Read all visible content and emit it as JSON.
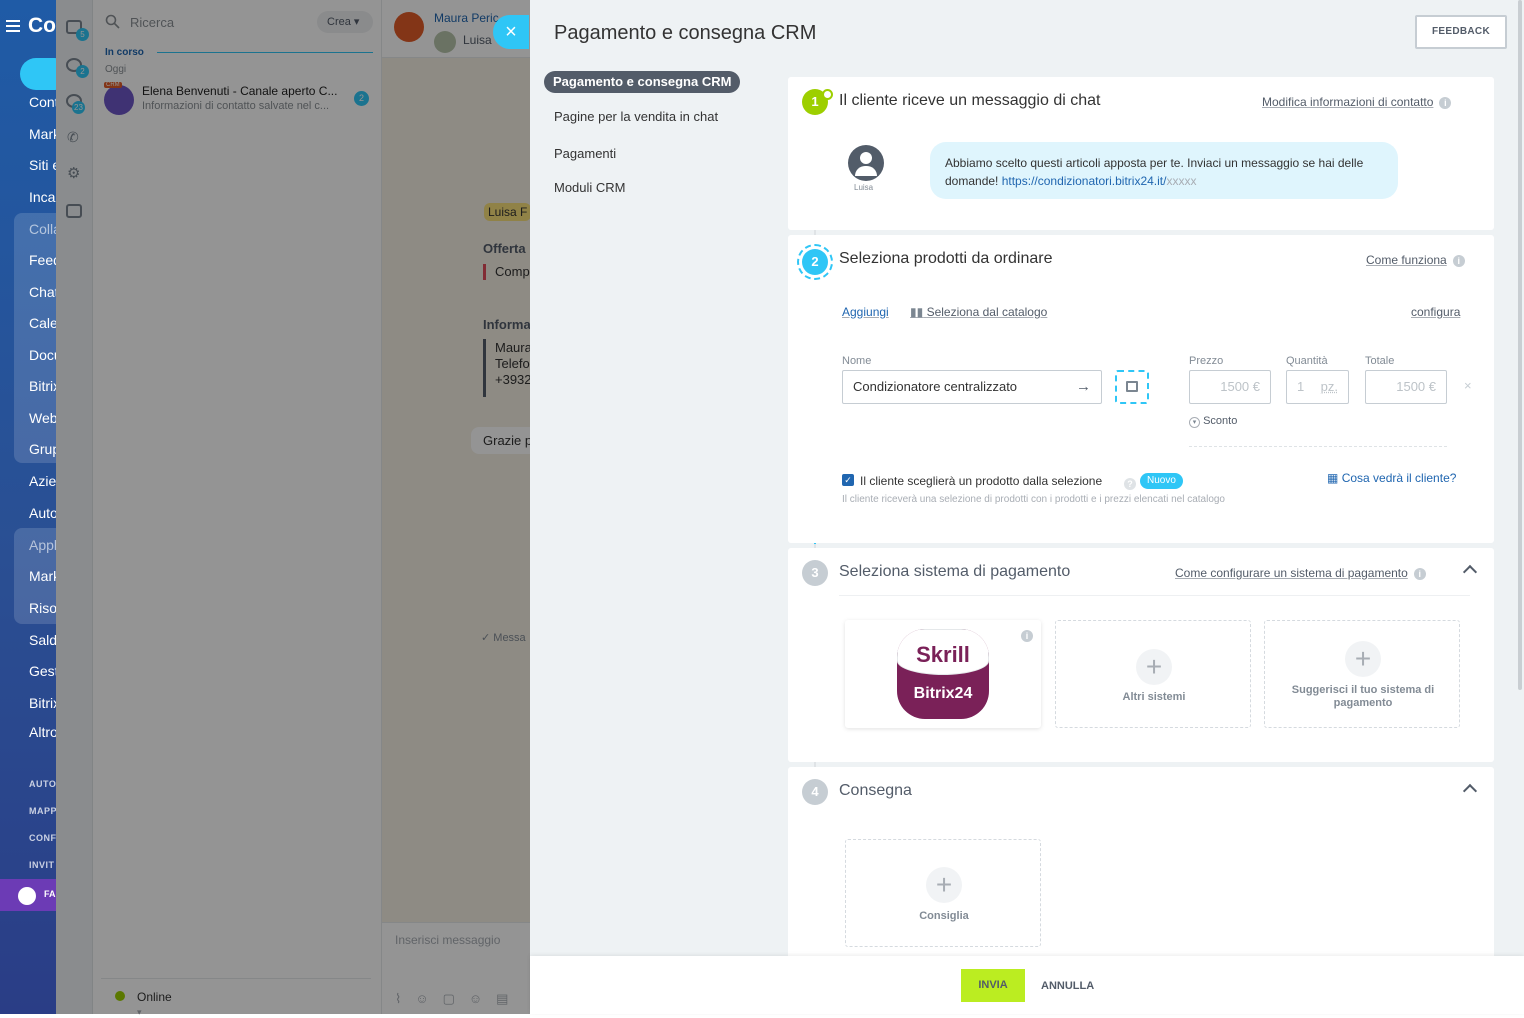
{
  "leftnav": {
    "brand": "Co",
    "items": [
      "Cont",
      "Mark",
      "Siti e",
      "Inca",
      "Colla",
      "Feed",
      "Chat",
      "Cale",
      "Docu",
      "Bitrix",
      "Web",
      "Grup",
      "Azie",
      "Auto",
      "Appl",
      "Mark",
      "Riso",
      "Sald",
      "Gest",
      "Bitrix",
      "Altro"
    ],
    "small": [
      "AUTO",
      "MAPP",
      "CONF",
      "INVIT"
    ],
    "fav": "FA"
  },
  "iconcol": {
    "badges": [
      "5",
      "2",
      "23"
    ]
  },
  "chatlist": {
    "search_placeholder": "Ricerca",
    "create_label": "Crea",
    "section": "In corso",
    "day": "Oggi",
    "chat": {
      "crm_tag": "CRM",
      "name": "Elena Benvenuti - Canale aperto C...",
      "snippet": "Informazioni di contatto salvate nel c...",
      "badge": "2"
    },
    "status": "Online"
  },
  "chatarea": {
    "contact_name": "Maura Peric",
    "contact_sub": "Luisa",
    "bubbles": [
      "Luisa F",
      "Offerta",
      "Comp",
      "Informa",
      "Maura",
      "Telefo",
      "+3932",
      "Grazie p",
      "Messa"
    ],
    "input_placeholder": "Inserisci messaggio"
  },
  "panel": {
    "title": "Pagamento e consegna CRM",
    "feedback": "FEEDBACK",
    "menu": [
      "Pagamento e consegna CRM",
      "Pagine per la vendita in chat",
      "Pagamenti",
      "Moduli CRM"
    ],
    "step1": {
      "num": "1",
      "title": "Il cliente riceve un messaggio di chat",
      "link": "Modifica informazioni di contatto",
      "avatar_name": "Luisa",
      "message": "Abbiamo scelto questi articoli apposta per te. Inviaci un messaggio se hai delle domande!",
      "url": "https://condizionatori.bitrix24.it/",
      "url_suffix": "xxxxx"
    },
    "step2": {
      "num": "2",
      "title": "Seleziona prodotti da ordinare",
      "link": "Come funziona",
      "add": "Aggiungi",
      "catalog": "Seleziona dal catalogo",
      "configure": "configura",
      "name_label": "Nome",
      "price_label": "Prezzo",
      "qty_label": "Quantità",
      "total_label": "Totale",
      "product": "Condizionatore centralizzato",
      "price": "1500 €",
      "qty": "1",
      "unit": "pz.",
      "total": "1500 €",
      "discount": "Sconto",
      "checkbox_label": "Il cliente sceglierà un prodotto dalla selezione",
      "new_badge": "Nuovo",
      "preview_link": "Cosa vedrà il cliente?",
      "hint": "Il cliente riceverà una selezione di prodotti con i prodotti e i prezzi elencati nel catalogo"
    },
    "step3": {
      "num": "3",
      "title": "Seleziona sistema di pagamento",
      "link": "Come configurare un sistema di pagamento",
      "skrill_top": "Skrill",
      "skrill_bottom": "Bitrix24",
      "other": "Altri sistemi",
      "suggest": "Suggerisci il tuo sistema di pagamento"
    },
    "step4": {
      "num": "4",
      "title": "Consegna",
      "recommend": "Consiglia"
    }
  },
  "footer": {
    "send": "INVIA",
    "cancel": "ANNULLA"
  },
  "colors": {
    "accent": "#2fc6f6",
    "green": "#9dcf00",
    "send": "#bbed21",
    "sidebar": "#1f5ba6"
  }
}
